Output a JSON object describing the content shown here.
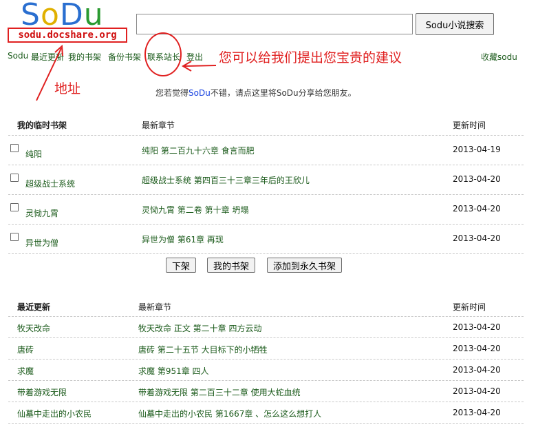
{
  "logo": {
    "letters": [
      "S",
      "o",
      "D",
      "u"
    ]
  },
  "site_address": "sodu.docshare.org",
  "search": {
    "value": "",
    "button_label": "Sodu小说搜索"
  },
  "nav": {
    "items": [
      "Sodu",
      "最近更新",
      "我的书架",
      "备份书架",
      "联系站长",
      "登出"
    ],
    "favorite": "收藏sodu"
  },
  "annotations": {
    "suggestion": "您可以给我们提出您宝贵的建议",
    "address": "地址"
  },
  "share": {
    "prefix": "您若觉得",
    "brand": "SoDu",
    "suffix": "不错，请点这里将SoDu分享给您朋友。"
  },
  "temp_shelf": {
    "headers": [
      "我的临时书架",
      "最新章节",
      "更新时间"
    ],
    "rows": [
      {
        "title": "纯阳",
        "chapter": "纯阳  第二百九十六章  食言而肥",
        "date": "2013-04-19"
      },
      {
        "title": "超级战士系统",
        "chapter": "超级战士系统  第四百三十三章三年后的王欣儿",
        "date": "2013-04-20"
      },
      {
        "title": "灵恸九霄",
        "chapter": "灵恸九霄  第二卷    第十章  坍塌",
        "date": "2013-04-20"
      },
      {
        "title": "异世为僧",
        "chapter": "异世为僧  第61章  再现",
        "date": "2013-04-20"
      }
    ],
    "buttons": [
      "下架",
      "我的书架",
      "添加到永久书架"
    ]
  },
  "recent": {
    "headers": [
      "最近更新",
      "最新章节",
      "更新时间"
    ],
    "rows": [
      {
        "title": "牧天改命",
        "chapter": "牧天改命  正文    第二十章  四方云动",
        "date": "2013-04-20"
      },
      {
        "title": "唐砖",
        "chapter": "唐砖  第二十五节  大目标下的小牺牲",
        "date": "2013-04-20"
      },
      {
        "title": "求魔",
        "chapter": "求魔  第951章  四人",
        "date": "2013-04-20"
      },
      {
        "title": "带着游戏无限",
        "chapter": "带着游戏无限  第二百三十二章  使用大蛇血统",
        "date": "2013-04-20"
      },
      {
        "title": "仙墓中走出的小农民",
        "chapter": "仙墓中走出的小农民  第1667章  、怎么这么想打人",
        "date": "2013-04-20"
      }
    ]
  },
  "colors": {
    "link_green": "#1a5a1a",
    "annotation_red": "#e02020",
    "brand_blue": "#1540e0"
  }
}
